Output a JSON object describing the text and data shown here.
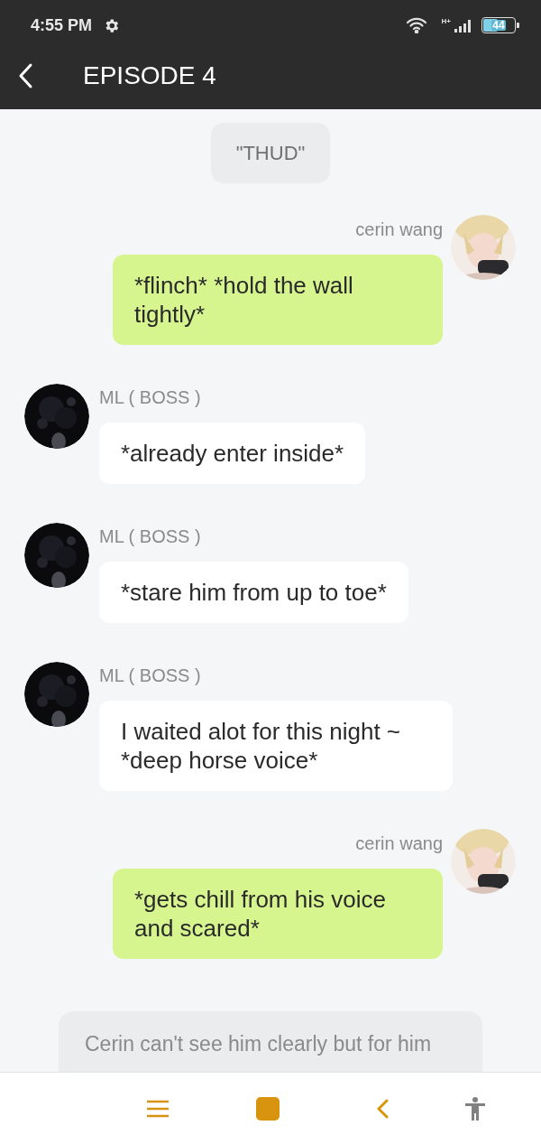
{
  "status_bar": {
    "time": "4:55 PM",
    "network": "H+",
    "battery": "44"
  },
  "header": {
    "title": "EPISODE 4"
  },
  "messages": [
    {
      "kind": "narration",
      "text": "\"THUD\""
    },
    {
      "kind": "user",
      "name": "cerin wang",
      "text": "*flinch* *hold the wall tightly*"
    },
    {
      "kind": "character",
      "name": "ML ( BOSS )",
      "text": "*already enter inside*"
    },
    {
      "kind": "character",
      "name": "ML ( BOSS )",
      "text": "*stare him from up to toe*"
    },
    {
      "kind": "character",
      "name": "ML ( BOSS )",
      "text": "I waited alot for this night ~ *deep horse voice*"
    },
    {
      "kind": "user",
      "name": "cerin wang",
      "text": "*gets chill from his voice and scared*"
    },
    {
      "kind": "narration_wide",
      "text": "Cerin can't see him clearly but for him"
    }
  ]
}
